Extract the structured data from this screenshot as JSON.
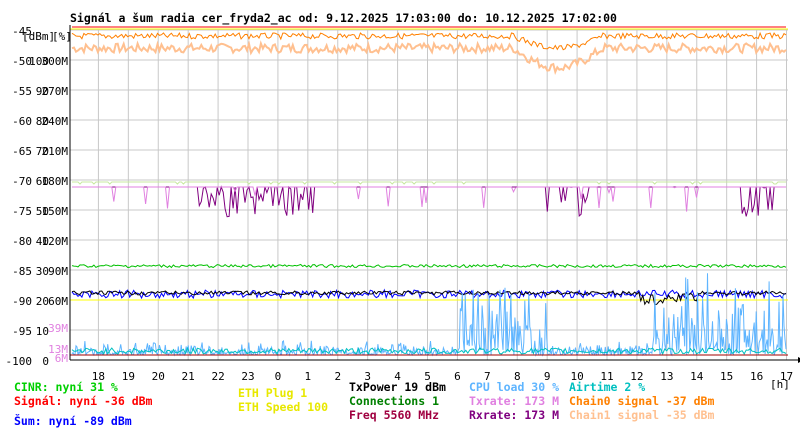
{
  "title": "Signál a šum radia cer_fryda2_ac od: 9.12.2025 17:03:00 do: 10.12.2025 17:02:00",
  "chart_data": {
    "type": "line",
    "title": "Signál a šum radia cer_fryda2_ac od: 9.12.2025 17:03:00 do: 10.12.2025 17:02:00",
    "y_header_dbm": "[dBm]",
    "y_header_pct": "[%]",
    "x_unit": "[h]",
    "x_ticks": [
      "18",
      "19",
      "20",
      "21",
      "22",
      "23",
      "0",
      "1",
      "2",
      "3",
      "4",
      "5",
      "6",
      "7",
      "8",
      "9",
      "10",
      "11",
      "12",
      "13",
      "14",
      "15",
      "16",
      "17"
    ],
    "y_dbm_ticks": [
      "-45",
      "-50",
      "-55",
      "-60",
      "-65",
      "-70",
      "-75",
      "-80",
      "-85",
      "-90",
      "-95",
      "-100"
    ],
    "y_pct_ticks": [
      "100",
      "90",
      "80",
      "70",
      "60",
      "50",
      "40",
      "30",
      "20",
      "10",
      "0"
    ],
    "y_rate_ticks": [
      "300M",
      "270M",
      "240M",
      "210M",
      "180M",
      "150M",
      "120M",
      "90M",
      "60M",
      "39M",
      "13M",
      "6M"
    ],
    "ylim_dbm": [
      -100,
      -45
    ],
    "xlim_hours": [
      17.05,
      17.03
    ],
    "grid": true,
    "series": [
      {
        "name": "CINR",
        "color": "#00c000",
        "unit": "%",
        "description_values": {
          "baseline": 31
        }
      },
      {
        "name": "Signál",
        "color": "#ff0000",
        "unit": "dBm",
        "description_values": {
          "baseline": -36
        }
      },
      {
        "name": "Šum",
        "color": "#0000ff",
        "unit": "dBm",
        "description_values": {
          "baseline": -89
        }
      },
      {
        "name": "ETH Plug",
        "color": "#ffff00",
        "description_values": {
          "baseline": 1
        }
      },
      {
        "name": "ETH Speed",
        "color": "#ffff00",
        "description_values": {
          "baseline": 100
        }
      },
      {
        "name": "TxPower",
        "color": "#000000",
        "unit": "dBm",
        "description_values": {
          "baseline": 19
        }
      },
      {
        "name": "Connections",
        "color": "#008000",
        "description_values": {
          "baseline": 1
        }
      },
      {
        "name": "Freq",
        "color": "#a00000",
        "unit": "MHz",
        "description_values": {
          "baseline": 5560
        }
      },
      {
        "name": "CPU load",
        "color": "#5fb5ff",
        "unit": "%",
        "description_values": {
          "baseline": 30
        }
      },
      {
        "name": "Txrate",
        "color": "#e080e0",
        "unit": "M",
        "description_values": {
          "baseline": 173
        }
      },
      {
        "name": "Rxrate",
        "color": "#800080",
        "unit": "M",
        "description_values": {
          "baseline": 173
        }
      },
      {
        "name": "Airtime",
        "color": "#00c0c0",
        "unit": "%",
        "description_values": {
          "baseline": 2
        }
      },
      {
        "name": "Chain0 signal",
        "color": "#ff8000",
        "unit": "dBm",
        "description_values": {
          "baseline": -37
        }
      },
      {
        "name": "Chain1 signal",
        "color": "#ffc090",
        "unit": "dBm",
        "description_values": {
          "baseline": -35
        }
      }
    ]
  },
  "legend": [
    {
      "text": "CINR: nyní 31 %",
      "color": "#00d000"
    },
    {
      "text": "Signál: nyní -36 dBm",
      "color": "#ff0000"
    },
    {
      "text": "Šum: nyní -89 dBm",
      "color": "#0000ff"
    },
    {
      "text": "ETH Plug 1",
      "color": "#ffff00"
    },
    {
      "text": "ETH Speed 100",
      "color": "#ffff00"
    },
    {
      "text": "TxPower 19 dBm",
      "color": "#000000"
    },
    {
      "text": "Connections 1",
      "color": "#008000"
    },
    {
      "text": "Freq 5560 MHz",
      "color": "#a00040"
    },
    {
      "text": "CPU load 30 %",
      "color": "#5fb5ff"
    },
    {
      "text": "Txrate: 173 M",
      "color": "#e080e0"
    },
    {
      "text": "Rxrate: 173 M",
      "color": "#800080"
    },
    {
      "text": "Airtime 2 %",
      "color": "#00c0c0"
    },
    {
      "text": "Chain0 signal -37 dBm",
      "color": "#ff8000"
    },
    {
      "text": "Chain1 signal -35 dBm",
      "color": "#ffc090"
    }
  ]
}
